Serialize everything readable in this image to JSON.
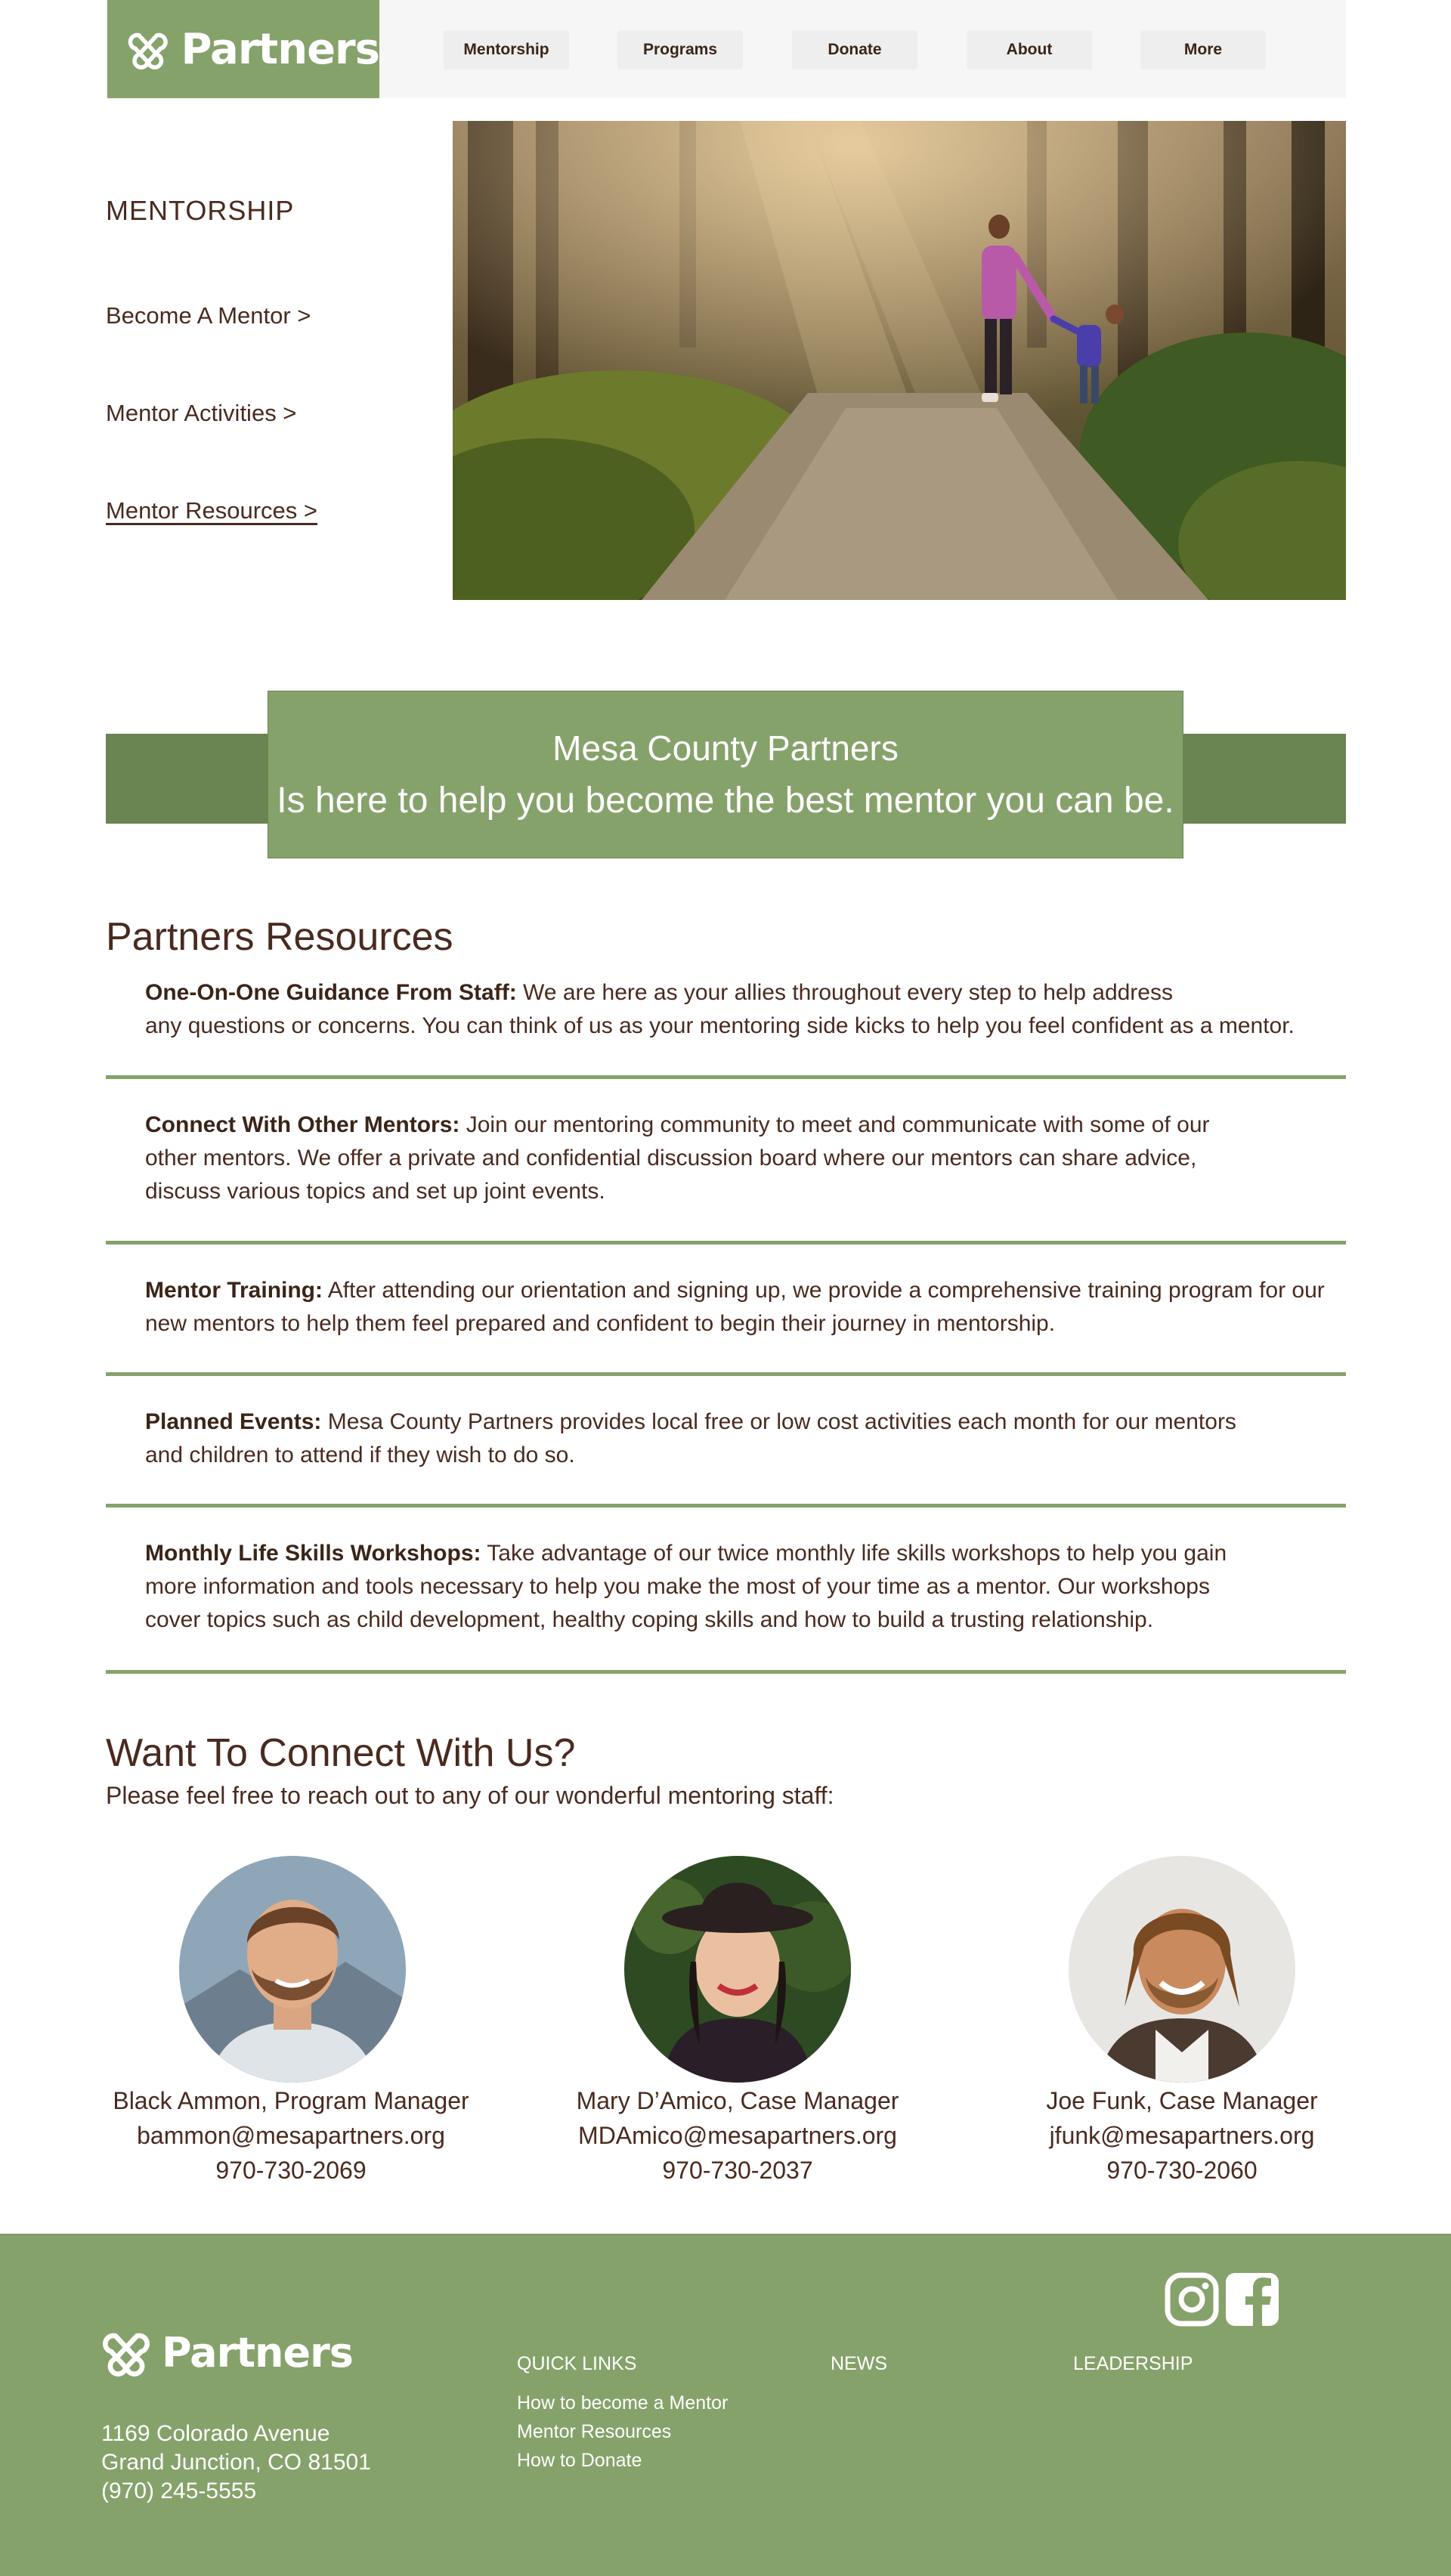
{
  "brand": {
    "name": "Partners",
    "color": "#86a26b",
    "dark_green": "#6b8552",
    "text_color": "#4a2a1f"
  },
  "nav": {
    "items": [
      {
        "label": "Mentorship"
      },
      {
        "label": "Programs"
      },
      {
        "label": "Donate"
      },
      {
        "label": "About"
      },
      {
        "label": "More"
      }
    ]
  },
  "sidebar": {
    "heading": "MENTORSHIP",
    "links": [
      {
        "label": "Become A Mentor >"
      },
      {
        "label": "Mentor Activities >"
      },
      {
        "label": "Mentor Resources >"
      }
    ]
  },
  "banner": {
    "line1": "Mesa County Partners",
    "line2": "Is here to help you become the best mentor you can be."
  },
  "resources": {
    "title": "Partners Resources",
    "items": [
      {
        "heading": "One-On-One Guidance From Staff:",
        "line1": "We are here as your allies throughout every step to help address",
        "line2": "any questions or concerns. You can think of us as your mentoring side kicks to help you feel confident as a mentor."
      },
      {
        "heading": "Connect With Other Mentors:",
        "line1": "Join our mentoring community to meet and communicate with some of our",
        "line2": "other mentors. We offer a private and confidential discussion board where our mentors can share advice,",
        "line3": "discuss various topics and set up joint events."
      },
      {
        "heading": "Mentor Training:",
        "line1": "After attending our orientation and signing up, we provide a comprehensive training program for our",
        "line2": "new mentors to help them feel prepared and confident to begin their journey in mentorship."
      },
      {
        "heading": "Planned Events:",
        "line1": "Mesa County Partners provides local free or low cost activities each month for our mentors",
        "line2": "and children to attend if they wish to do so."
      },
      {
        "heading": "Monthly Life Skills Workshops:",
        "line1": "Take advantage of our twice monthly life skills workshops to help you gain",
        "line2": "more information and tools necessary to help you make the most of your time as a mentor. Our workshops",
        "line3": "cover topics such as child development, healthy coping skills and how to build a trusting relationship."
      }
    ]
  },
  "connect": {
    "title": "Want To Connect With Us?",
    "subtitle": "Please feel free to reach out to any of our wonderful mentoring staff:",
    "staff": [
      {
        "name": "Black Ammon, Program Manager",
        "email": "bammon@mesapartners.org",
        "phone": "970-730-2069"
      },
      {
        "name": "Mary D’Amico, Case Manager",
        "email": "MDAmico@mesapartners.org",
        "phone": "970-730-2037"
      },
      {
        "name": "Joe Funk, Case Manager",
        "email": "jfunk@mesapartners.org",
        "phone": "970-730-2060"
      }
    ]
  },
  "footer": {
    "brand": "Partners",
    "address_line1": "1169 Colorado Avenue",
    "address_line2": "Grand Junction, CO 81501",
    "phone": "(970) 245-5555",
    "quick_links_heading": "QUICK LINKS",
    "news_heading": "NEWS",
    "leadership_heading": "LEADERSHIP",
    "quick_links": [
      {
        "label": "How to become a Mentor"
      },
      {
        "label": "Mentor Resources"
      },
      {
        "label": "How to Donate"
      }
    ],
    "social": [
      "instagram-icon",
      "facebook-icon"
    ]
  }
}
